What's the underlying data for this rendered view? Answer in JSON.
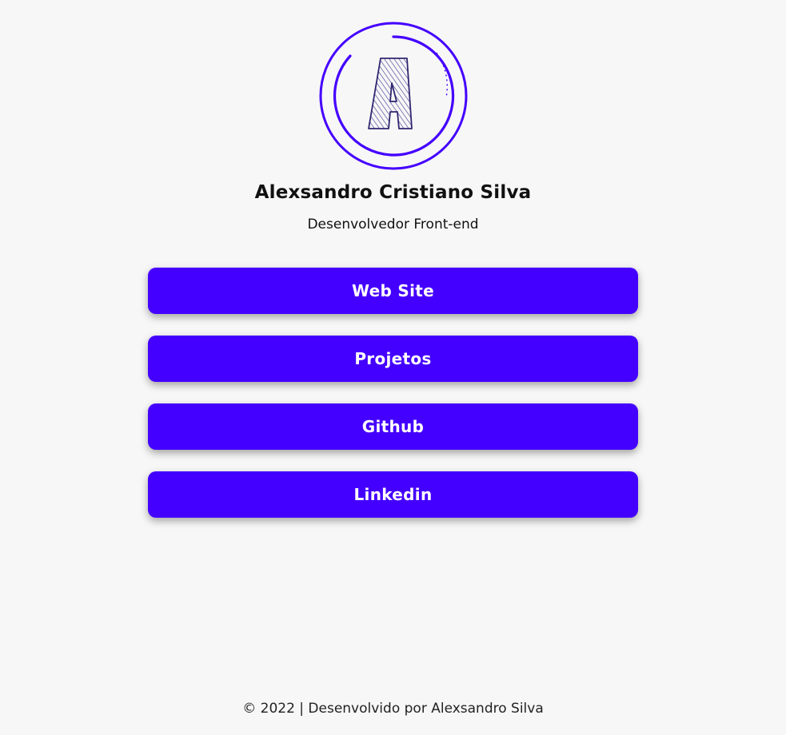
{
  "profile": {
    "avatar_icon": "letter-a-logo-icon",
    "avatar_letter": "A",
    "name": "Alexsandro Cristiano Silva",
    "role": "Desenvolvedor Front-end"
  },
  "links": [
    {
      "label": "Web Site"
    },
    {
      "label": "Projetos"
    },
    {
      "label": "Github"
    },
    {
      "label": "Linkedin"
    }
  ],
  "footer": {
    "text": "© 2022 | Desenvolvido por Alexsandro Silva"
  },
  "colors": {
    "accent": "#4400ff",
    "background": "#f7f7f7",
    "button_text": "#ffffff"
  }
}
